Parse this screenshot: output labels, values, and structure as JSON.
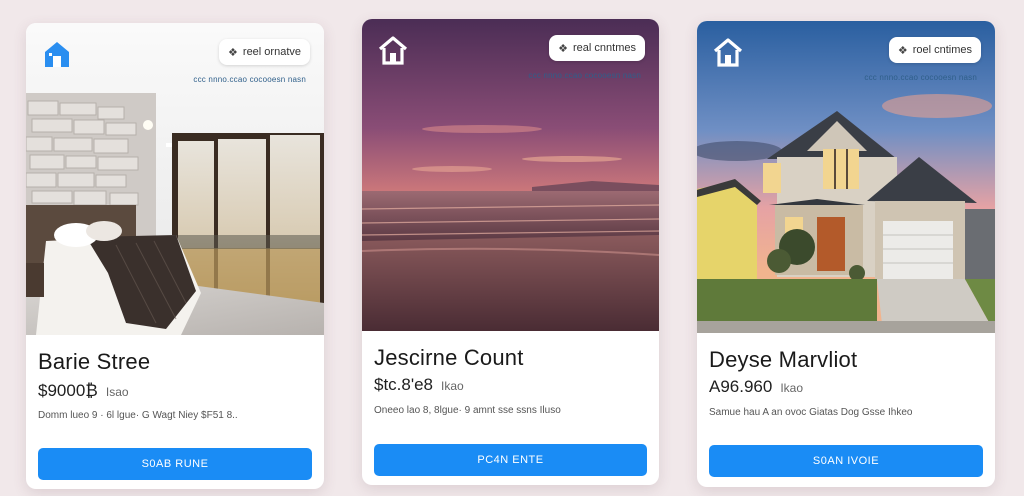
{
  "cards": [
    {
      "badge": "reel ornatve",
      "subbadge": "ccc nnno.ccao cocooesn nasn",
      "title": "Barie Stree",
      "price": "$9000₿",
      "price_unit": "Isao",
      "description": "Domm lueo  9 ·  6l  lgue·   G Wagt  Niey  $F51 8..",
      "button": "S0AB RUNE",
      "scene": "bedroom",
      "home_icon_color": "#2a8ef0"
    },
    {
      "badge": "real cnntmes",
      "subbadge": "ccc nnno.ccao cocooesn nasn",
      "title": "Jescirne Count",
      "price": "$tc.8'e8",
      "price_unit": "Ikao",
      "description": "Oneeo lao 8,  8lgue·  9 amnt  sse ssns  Iluso",
      "button": "PC4N ENTE",
      "scene": "beach-sunset",
      "home_icon_color": "#ffffff"
    },
    {
      "badge": "roel cntimes",
      "subbadge": "ccc nnno.ccao cocooesn nasn",
      "title": "Deyse Marvliot",
      "price": "A96.960",
      "price_unit": "Ikao",
      "description": "Samue hau  A  an  ovoc  Giatas  Dog  Gsse  Ihkeo",
      "button": "S0AN IVOIE",
      "scene": "house-exterior",
      "home_icon_color": "#ffffff"
    }
  ],
  "colors": {
    "accent": "#1a8cf5",
    "background": "#f1e8ea"
  }
}
